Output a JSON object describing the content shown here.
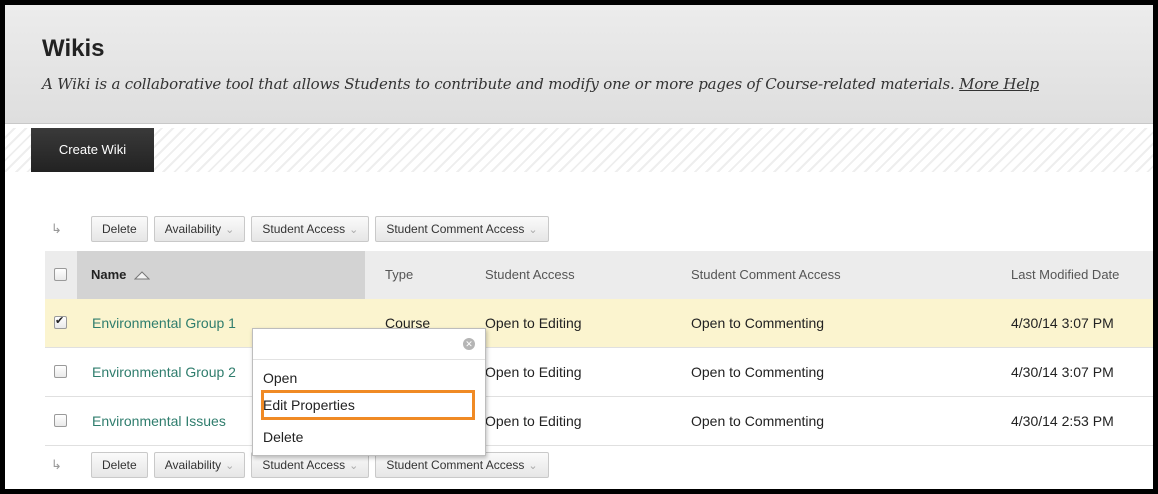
{
  "header": {
    "title": "Wikis",
    "description": "A Wiki is a collaborative tool that allows Students to contribute and modify one or more pages of Course-related materials.",
    "more_help": "More Help"
  },
  "action_bar": {
    "create_label": "Create Wiki"
  },
  "list_buttons": {
    "delete": "Delete",
    "availability": "Availability",
    "student_access": "Student Access",
    "student_comment_access": "Student Comment Access"
  },
  "table": {
    "columns": {
      "name": "Name",
      "type": "Type",
      "student_access": "Student Access",
      "comment_access": "Student Comment Access",
      "modified": "Last Modified Date"
    },
    "sort_direction": "ascending",
    "rows": [
      {
        "name": "Environmental Group 1",
        "type": "Course",
        "student_access": "Open to Editing",
        "comment_access": "Open to Commenting",
        "modified": "4/30/14 3:07 PM",
        "checked": true
      },
      {
        "name": "Environmental Group 2",
        "type": "",
        "student_access": "Open to Editing",
        "comment_access": "Open to Commenting",
        "modified": "4/30/14 3:07 PM",
        "checked": false
      },
      {
        "name": "Environmental Issues",
        "type": "",
        "student_access": "Open to Editing",
        "comment_access": "Open to Commenting",
        "modified": "4/30/14 2:53 PM",
        "checked": false
      }
    ]
  },
  "context_menu": {
    "items": [
      "Open",
      "Edit Properties",
      "Delete"
    ],
    "highlighted_item": "Edit Properties",
    "highlight_color": "#f08a24"
  },
  "icons": {
    "sort": "triangle-up-icon",
    "chevron": "double-chevron-down-icon",
    "close": "close-circle-icon",
    "arrow": "corner-arrow-icon"
  }
}
